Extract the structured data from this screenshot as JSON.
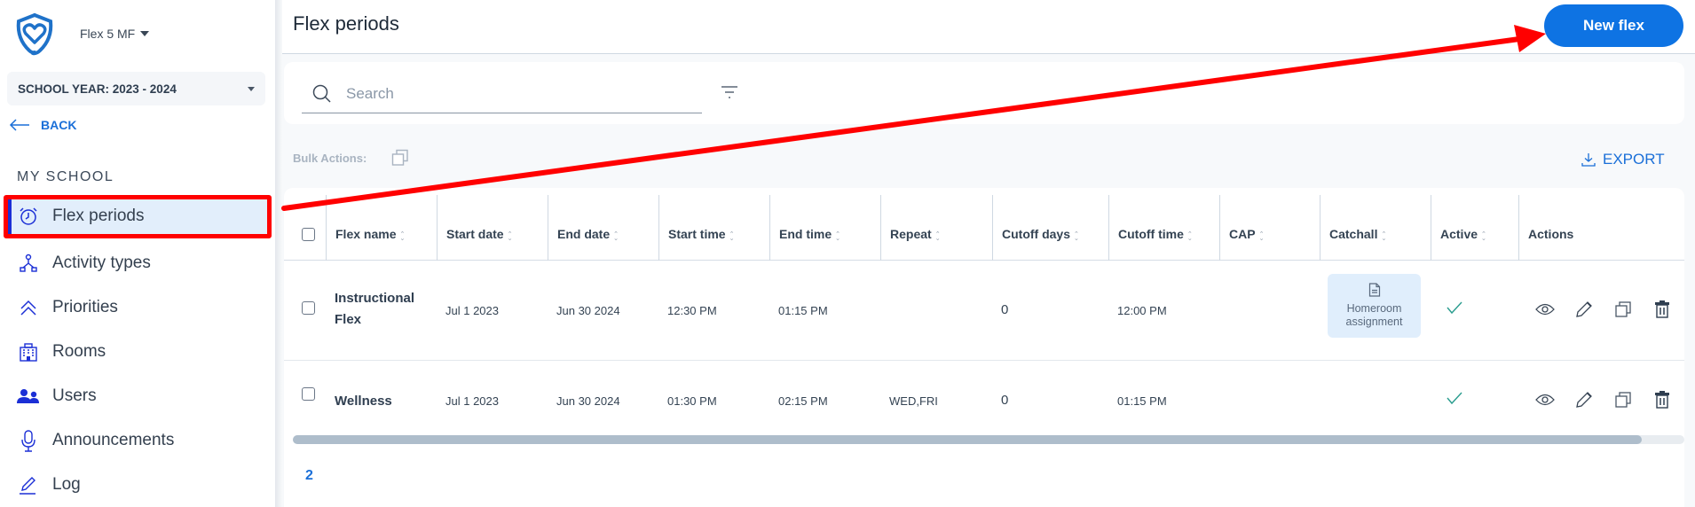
{
  "app": {
    "org_name": "Flex 5 MF",
    "school_year": "SCHOOL YEAR: 2023 - 2024",
    "back_label": "BACK",
    "section_label": "MY SCHOOL"
  },
  "sidebar": {
    "items": [
      {
        "label": "Flex periods",
        "icon": "alarm-clock-icon",
        "active": true
      },
      {
        "label": "Activity types",
        "icon": "hierarchy-icon"
      },
      {
        "label": "Priorities",
        "icon": "double-chevron-up-icon"
      },
      {
        "label": "Rooms",
        "icon": "building-icon"
      },
      {
        "label": "Users",
        "icon": "users-icon"
      },
      {
        "label": "Announcements",
        "icon": "microphone-icon"
      },
      {
        "label": "Log",
        "icon": "pencil-icon"
      }
    ]
  },
  "header": {
    "title": "Flex periods",
    "new_button": "New flex"
  },
  "search": {
    "placeholder": "Search",
    "value": ""
  },
  "toolbar": {
    "bulk_actions_label": "Bulk Actions:",
    "export_label": "EXPORT"
  },
  "table": {
    "columns": [
      "Flex name",
      "Start date",
      "End date",
      "Start time",
      "End time",
      "Repeat",
      "Cutoff days",
      "Cutoff time",
      "CAP",
      "Catchall",
      "Active",
      "Actions"
    ],
    "rows": [
      {
        "flex_name": "Instructional Flex",
        "start_date": "Jul 1 2023",
        "end_date": "Jun 30 2024",
        "start_time": "12:30 PM",
        "end_time": "01:15 PM",
        "repeat": "",
        "cutoff_days": "0",
        "cutoff_time": "12:00 PM",
        "cap": "",
        "catchall": "Homeroom assignment",
        "active": true
      },
      {
        "flex_name": "Wellness",
        "start_date": "Jul 1 2023",
        "end_date": "Jun 30 2024",
        "start_time": "01:30 PM",
        "end_time": "02:15 PM",
        "repeat": "WED,FRI",
        "cutoff_days": "0",
        "cutoff_time": "01:15 PM",
        "cap": "",
        "catchall": "",
        "active": true
      }
    ]
  },
  "pagination": {
    "current_page": "2"
  },
  "colors": {
    "accent": "#0e73e3",
    "link": "#1a6fd8",
    "active_nav_bg": "#e2eefb",
    "active_nav_bar": "#1b2fd6",
    "annotation": "#ff0000",
    "check": "#2a9d8f"
  }
}
